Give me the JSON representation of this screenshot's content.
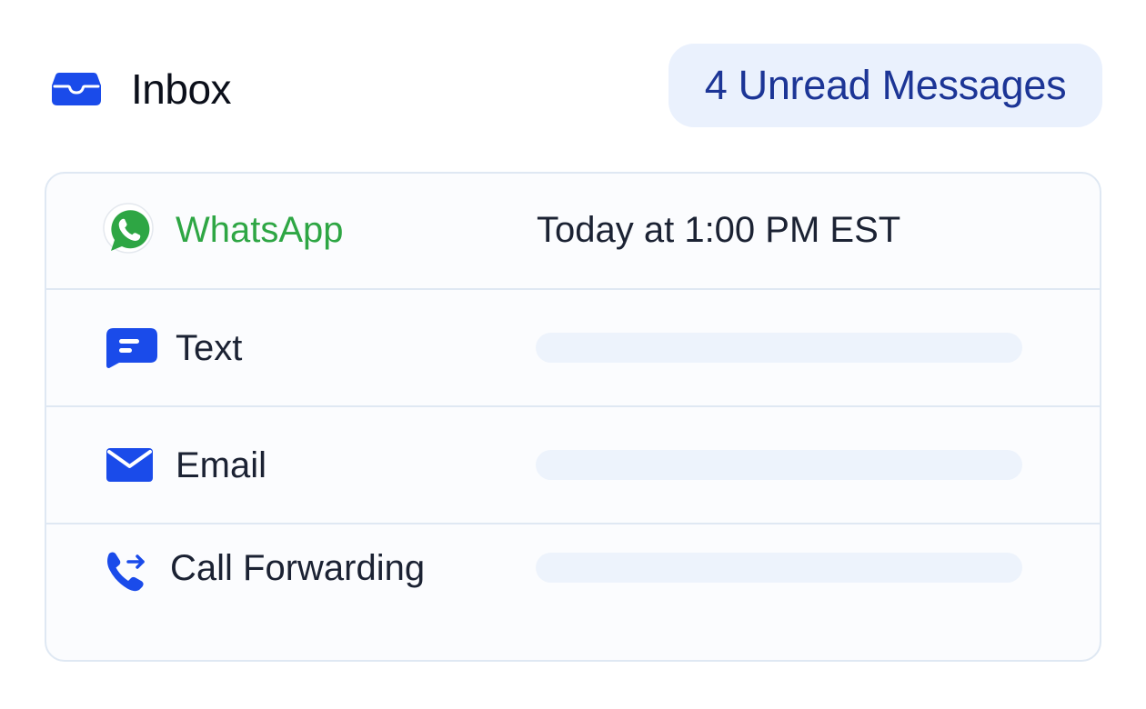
{
  "header": {
    "title": "Inbox",
    "title_icon": "inbox-icon",
    "unread_badge": "4 Unread Messages"
  },
  "colors": {
    "accent_blue": "#1a4bea",
    "whatsapp_green": "#2ea644",
    "badge_bg": "#eaf1fd",
    "badge_text": "#1c3596",
    "border": "#dfe8f3"
  },
  "channels": [
    {
      "label": "WhatsApp",
      "icon": "whatsapp-icon",
      "status": "Today at 1:00 PM EST"
    },
    {
      "label": "Text",
      "icon": "text-message-icon"
    },
    {
      "label": "Email",
      "icon": "envelope-icon"
    },
    {
      "label": "Call Forwarding",
      "icon": "phone-forward-icon"
    }
  ]
}
